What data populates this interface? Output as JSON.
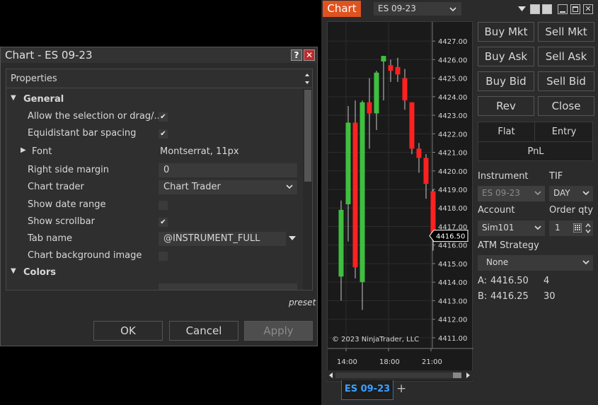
{
  "dialog": {
    "title": "Chart - ES 09-23",
    "help": "?",
    "close": "✕",
    "properties_header": "Properties",
    "categories": {
      "general": "General",
      "colors": "Colors"
    },
    "rows": [
      {
        "label": "Allow the selection or drag/...",
        "type": "check",
        "checked": "✔"
      },
      {
        "label": "Equidistant bar spacing",
        "type": "check",
        "checked": "✔"
      },
      {
        "label": "Font",
        "type": "text",
        "value": "Montserrat, 11px"
      },
      {
        "label": "Right side margin",
        "type": "input",
        "value": "0"
      },
      {
        "label": "Chart trader",
        "type": "select",
        "value": "Chart Trader"
      },
      {
        "label": "Show date range",
        "type": "check",
        "checked": ""
      },
      {
        "label": "Show scrollbar",
        "type": "check",
        "checked": "✔"
      },
      {
        "label": "Tab name",
        "type": "input",
        "value": "@INSTRUMENT_FULL"
      },
      {
        "label": "Chart background image",
        "type": "check",
        "checked": ""
      }
    ],
    "preset": "preset",
    "ok": "OK",
    "cancel": "Cancel",
    "apply": "Apply"
  },
  "chart_window": {
    "tab": "Chart",
    "instrument": "ES 09-23",
    "copyright": "© 2023 NinjaTrader, LLC",
    "bottom_tab": "ES 09-23",
    "add_tab": "+"
  },
  "chart_trader": {
    "buttons": [
      "Buy Mkt",
      "Sell Mkt",
      "Buy Ask",
      "Sell Ask",
      "Buy Bid",
      "Sell Bid",
      "Rev",
      "Close"
    ],
    "position": {
      "flat": "Flat",
      "entry": "Entry",
      "pnl": "PnL"
    },
    "instrument_label": "Instrument",
    "instrument_value": "ES 09-23",
    "tif_label": "TIF",
    "tif_value": "DAY",
    "account_label": "Account",
    "account_value": "Sim101",
    "qty_label": "Order qty",
    "qty_value": "1",
    "atm_label": "ATM Strategy",
    "atm_value": "None",
    "ask_label": "A:",
    "ask_price": "4416.50",
    "ask_size": "4",
    "bid_label": "B:",
    "bid_price": "4416.25",
    "bid_size": "30"
  },
  "chart_data": {
    "type": "candlestick",
    "instrument": "ES 09-23",
    "y_ticks": [
      "4427.00",
      "4426.00",
      "4425.00",
      "4424.00",
      "4423.00",
      "4422.00",
      "4421.00",
      "4420.00",
      "4419.00",
      "4418.00",
      "4417.00",
      "4416.00",
      "4415.00",
      "4414.00",
      "4413.00",
      "4412.00",
      "4411.00"
    ],
    "x_ticks": [
      "14:00",
      "18:00",
      "21:00"
    ],
    "ylim": [
      4410.5,
      4427.5
    ],
    "last_price_label": "4416.50",
    "last_price": 4416.5,
    "candles": [
      {
        "o": 4414.3,
        "h": 4418.4,
        "l": 4413.0,
        "c": 4417.9
      },
      {
        "o": 4418.2,
        "h": 4423.5,
        "l": 4416.2,
        "c": 4422.6
      },
      {
        "o": 4422.6,
        "h": 4423.8,
        "l": 4414.2,
        "c": 4414.8
      },
      {
        "o": 4414.0,
        "h": 4423.8,
        "l": 4412.5,
        "c": 4423.7
      },
      {
        "o": 4423.7,
        "h": 4425.0,
        "l": 4421.2,
        "c": 4423.1
      },
      {
        "o": 4423.1,
        "h": 4425.4,
        "l": 4422.2,
        "c": 4425.3
      },
      {
        "o": 4425.9,
        "h": 4426.2,
        "l": 4423.8,
        "c": 4426.2
      },
      {
        "o": 4425.7,
        "h": 4426.0,
        "l": 4424.8,
        "c": 4425.4
      },
      {
        "o": 4425.6,
        "h": 4426.1,
        "l": 4424.8,
        "c": 4425.2
      },
      {
        "o": 4425.0,
        "h": 4425.5,
        "l": 4423.3,
        "c": 4423.8
      },
      {
        "o": 4423.7,
        "h": 4423.7,
        "l": 4420.9,
        "c": 4421.2
      },
      {
        "o": 4421.2,
        "h": 4421.5,
        "l": 4419.9,
        "c": 4420.7
      },
      {
        "o": 4420.7,
        "h": 4420.9,
        "l": 4418.5,
        "c": 4419.3
      },
      {
        "o": 4418.9,
        "h": 4419.0,
        "l": 4415.7,
        "c": 4416.5
      }
    ],
    "colors": {
      "up": "#3fbf3f",
      "down": "#ff2020"
    }
  }
}
